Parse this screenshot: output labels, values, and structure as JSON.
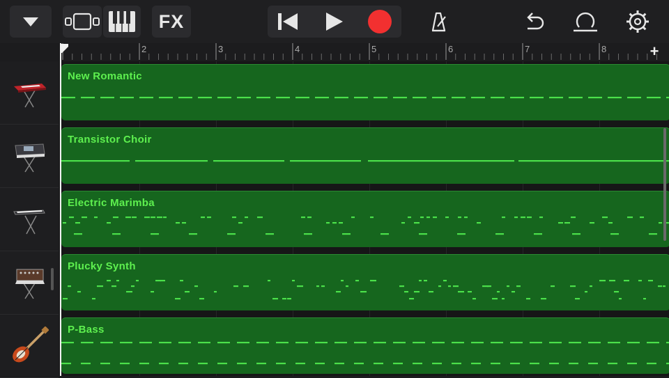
{
  "toolbar": {
    "fx_label": "FX",
    "record_color": "#f23030",
    "buttons": [
      "dropdown-icon",
      "tracks-view-icon",
      "keyboard-icon",
      "fx",
      "rewind-icon",
      "play-icon",
      "record-icon",
      "metronome-icon",
      "undo-icon",
      "loop-icon",
      "settings-icon"
    ]
  },
  "ruler": {
    "bars": [
      "2",
      "3",
      "4",
      "5",
      "6",
      "7",
      "8"
    ],
    "add_label": "+"
  },
  "tracks": [
    {
      "name": "New Romantic",
      "instrument": "red-synth-keyboard-icon"
    },
    {
      "name": "Transistor Choir",
      "instrument": "synth-workstation-icon"
    },
    {
      "name": "Electric Marimba",
      "instrument": "stage-keyboard-icon"
    },
    {
      "name": "Plucky Synth",
      "instrument": "modular-synth-icon"
    },
    {
      "name": "P-Bass",
      "instrument": "bass-guitar-icon"
    }
  ],
  "colors": {
    "region": "#16661e",
    "region_text": "#5ef04f",
    "note": "#4be04a"
  }
}
